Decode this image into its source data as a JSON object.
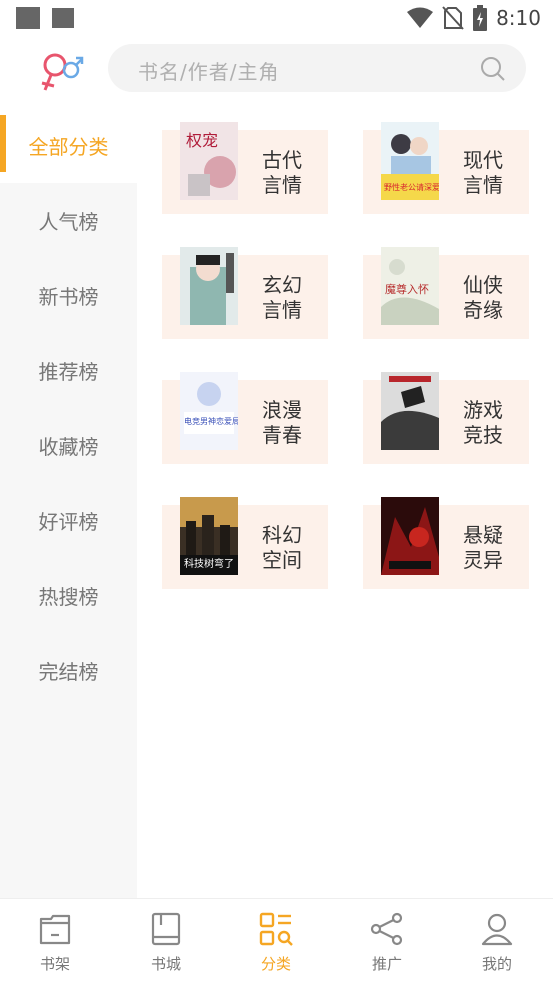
{
  "status_bar": {
    "time": "8:10"
  },
  "search": {
    "placeholder": "书名/作者/主角"
  },
  "sidebar": {
    "items": [
      {
        "label": "全部分类",
        "active": true
      },
      {
        "label": "人气榜"
      },
      {
        "label": "新书榜"
      },
      {
        "label": "推荐榜"
      },
      {
        "label": "收藏榜"
      },
      {
        "label": "好评榜"
      },
      {
        "label": "热搜榜"
      },
      {
        "label": "完结榜"
      }
    ]
  },
  "categories": [
    {
      "line1": "古代",
      "line2": "言情",
      "cover_text": "权宠"
    },
    {
      "line1": "现代",
      "line2": "言情",
      "cover_text": "野性老公请深爱!"
    },
    {
      "line1": "玄幻",
      "line2": "言情",
      "cover_text": ""
    },
    {
      "line1": "仙侠",
      "line2": "奇缘",
      "cover_text": "魔尊入怀"
    },
    {
      "line1": "浪漫",
      "line2": "青春",
      "cover_text": "电竞男神恋爱局"
    },
    {
      "line1": "游戏",
      "line2": "竞技",
      "cover_text": ""
    },
    {
      "line1": "科幻",
      "line2": "空间",
      "cover_text": "科技树弯了"
    },
    {
      "line1": "悬疑",
      "line2": "灵异",
      "cover_text": ""
    }
  ],
  "bottom_nav": [
    {
      "label": "书架",
      "icon": "bookshelf-icon"
    },
    {
      "label": "书城",
      "icon": "bookstore-icon"
    },
    {
      "label": "分类",
      "icon": "category-icon",
      "active": true
    },
    {
      "label": "推广",
      "icon": "share-icon"
    },
    {
      "label": "我的",
      "icon": "profile-icon"
    }
  ],
  "colors": {
    "accent": "#f5a623",
    "card_bg": "#fdf1ea",
    "sidebar_bg": "#f7f7f7"
  }
}
